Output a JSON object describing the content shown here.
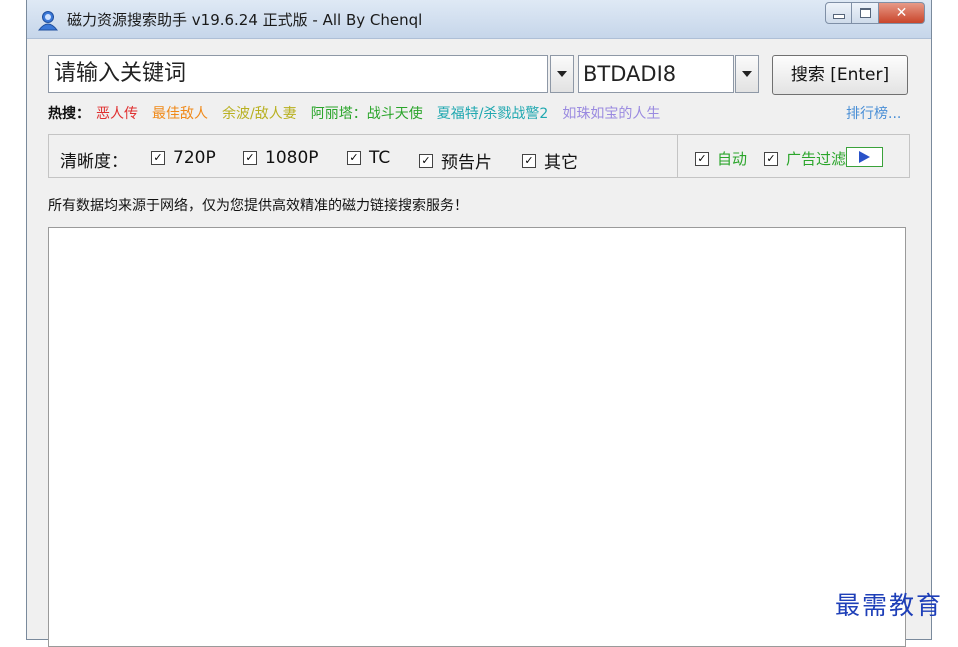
{
  "window": {
    "title": "磁力资源搜索助手 v19.6.24 正式版 - All By Chenql"
  },
  "search": {
    "placeholder": "请输入关键词",
    "source": "BTDADI8",
    "button_label": "搜索 [Enter]"
  },
  "hot": {
    "label": "热搜：",
    "items": [
      {
        "text": "恶人传",
        "color": "#e03030"
      },
      {
        "text": "最佳敌人",
        "color": "#f08a1a"
      },
      {
        "text": "余波/敌人妻",
        "color": "#b8b020"
      },
      {
        "text": "阿丽塔：战斗天使",
        "color": "#2aa52a"
      },
      {
        "text": "夏福特/杀戮战警2",
        "color": "#20a8b0"
      },
      {
        "text": "如珠如宝的人生",
        "color": "#9a8ae0"
      }
    ],
    "more_link": "排行榜..."
  },
  "quality": {
    "label": "清晰度：",
    "options": [
      {
        "label": "720P",
        "checked": true
      },
      {
        "label": "1080P",
        "checked": true
      },
      {
        "label": "TC",
        "checked": true
      },
      {
        "label": "预告片",
        "checked": true
      },
      {
        "label": "其它",
        "checked": true
      }
    ],
    "auto_label": "自动",
    "ad_filter_label": "广告过滤"
  },
  "notice": "所有数据均来源于网络，仅为您提供高效精准的磁力链接搜索服务！",
  "watermark": "最需教育",
  "icons": {
    "app": "user-icon",
    "minimize": "minimize-icon",
    "maximize": "maximize-icon",
    "close": "close-icon",
    "dropdown": "chevron-down-icon",
    "play": "play-icon",
    "checkmark": "checkmark-icon"
  }
}
